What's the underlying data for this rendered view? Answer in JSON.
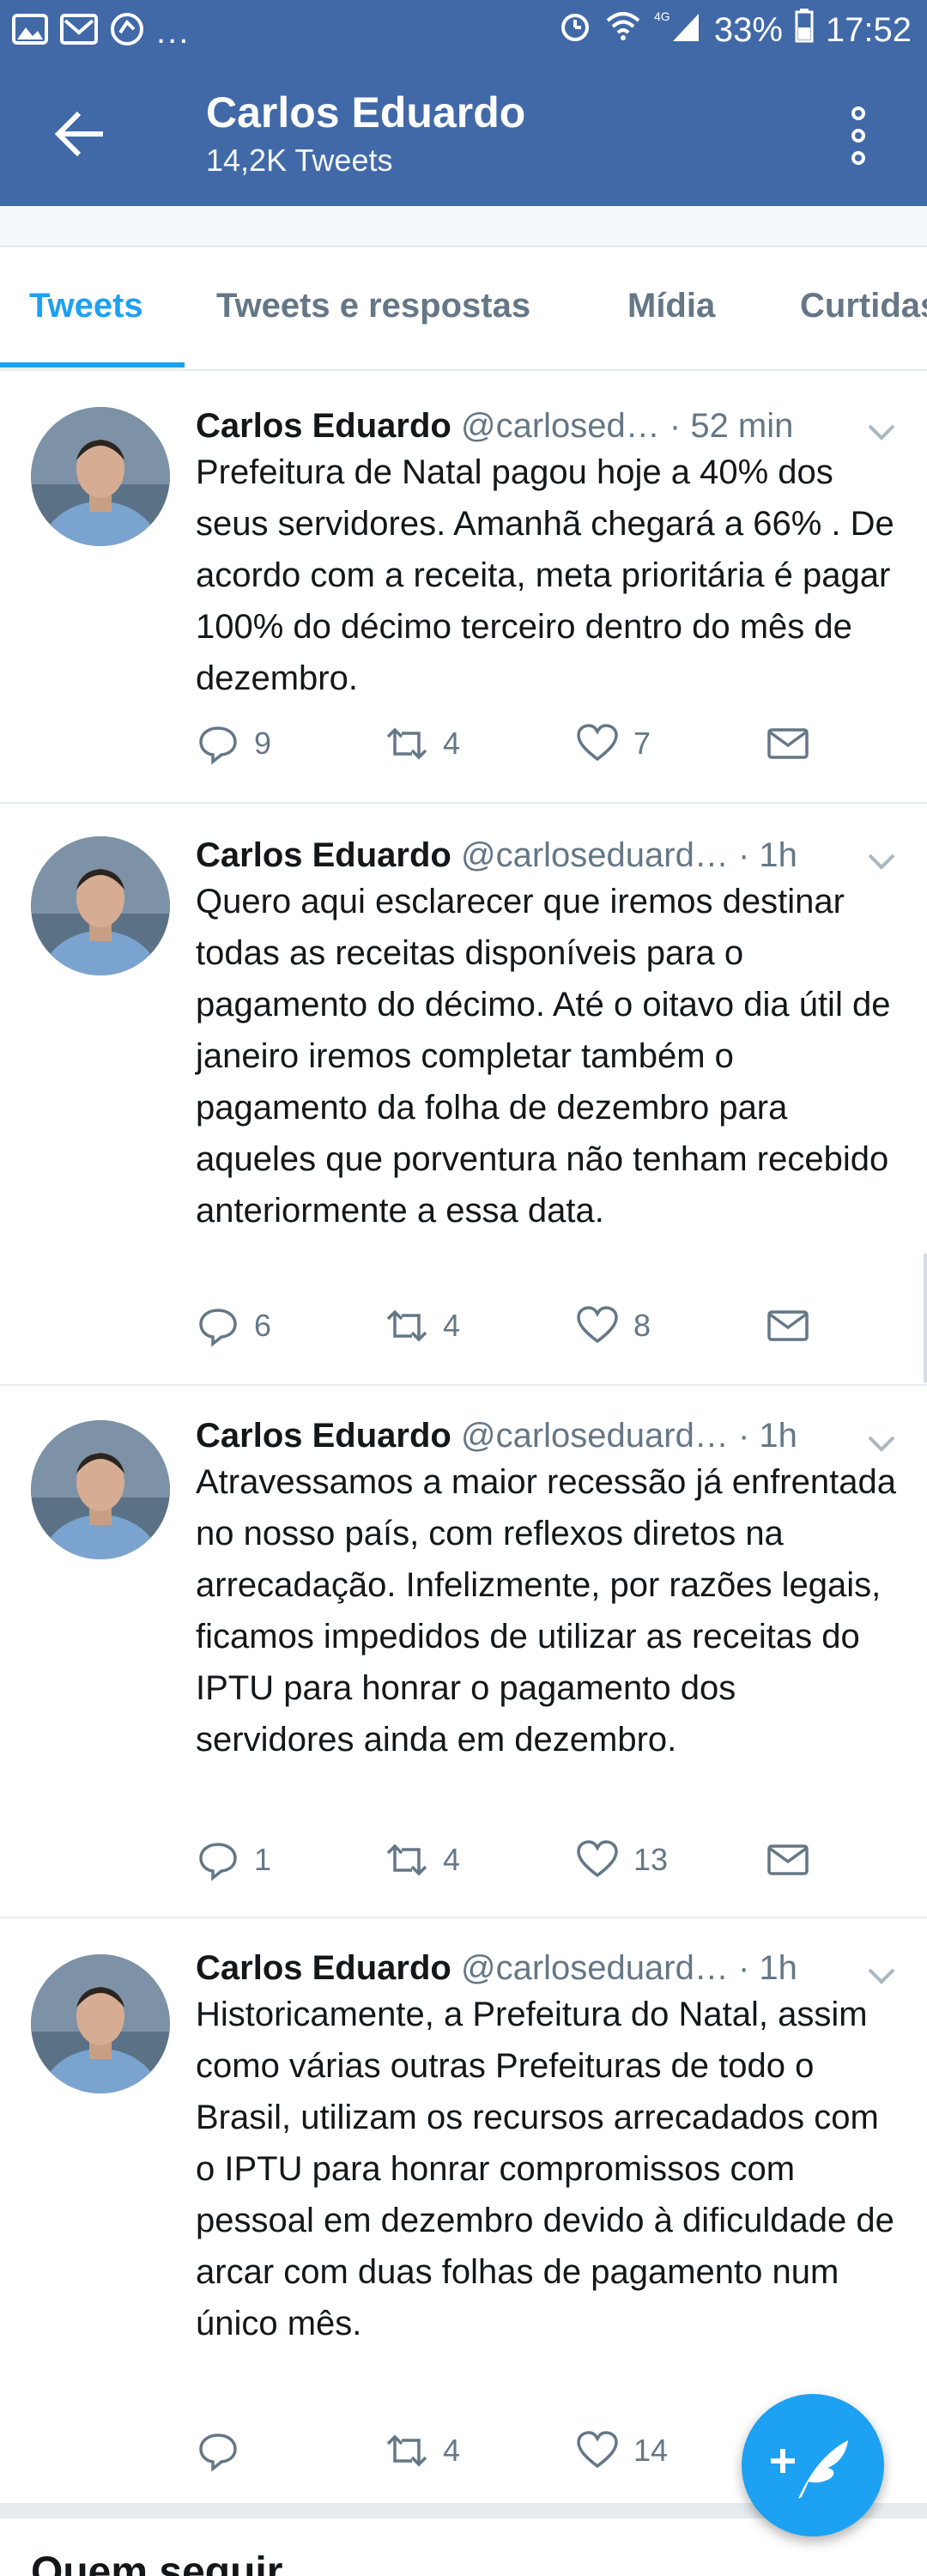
{
  "status_bar": {
    "battery": "33%",
    "time": "17:52",
    "network": "4G",
    "more": "..."
  },
  "header": {
    "name": "Carlos Eduardo",
    "tweet_count": "14,2K Tweets"
  },
  "tabs": [
    {
      "label": "Tweets"
    },
    {
      "label": "Tweets e respostas"
    },
    {
      "label": "Mídia"
    },
    {
      "label": "Curtidas"
    }
  ],
  "tweets": [
    {
      "name": "Carlos Eduardo",
      "handle": "@carlosed…",
      "time": "· 52 min",
      "text": "Prefeitura de Natal pagou hoje a 40% dos seus servidores. Amanhã chegará a 66% . De acordo com a receita, meta prioritária é pagar 100%  do décimo terceiro dentro do mês de dezembro.",
      "replies": "9",
      "retweets": "4",
      "likes": "7"
    },
    {
      "name": "Carlos Eduardo",
      "handle": "@carloseduard…",
      "time": "· 1h",
      "text": "Quero aqui esclarecer que iremos destinar todas as receitas disponíveis para o pagamento do décimo. Até o oitavo dia útil de janeiro iremos completar também o pagamento da folha de dezembro para aqueles que porventura não tenham recebido anteriormente a essa data.",
      "replies": "6",
      "retweets": "4",
      "likes": "8"
    },
    {
      "name": "Carlos Eduardo",
      "handle": "@carloseduard…",
      "time": "· 1h",
      "text": "Atravessamos a maior recessão já enfrentada no nosso país, com reflexos diretos na arrecadação. Infelizmente, por razões legais, ficamos impedidos de utilizar as receitas do IPTU para honrar o pagamento dos servidores ainda em dezembro.",
      "replies": "1",
      "retweets": "4",
      "likes": "13"
    },
    {
      "name": "Carlos Eduardo",
      "handle": "@carloseduard…",
      "time": "· 1h",
      "text": "Historicamente, a Prefeitura do Natal, assim como várias outras Prefeituras de todo o Brasil, utilizam os recursos arrecadados com o IPTU para honrar compromissos com pessoal em dezembro devido à dificuldade de arcar com duas folhas de pagamento num único mês.",
      "replies": "",
      "retweets": "4",
      "likes": "14"
    }
  ],
  "who_to_follow": "Quem seguir",
  "colors": {
    "header_bg": "#4169a8",
    "accent": "#1da1f2",
    "muted": "#657786"
  }
}
